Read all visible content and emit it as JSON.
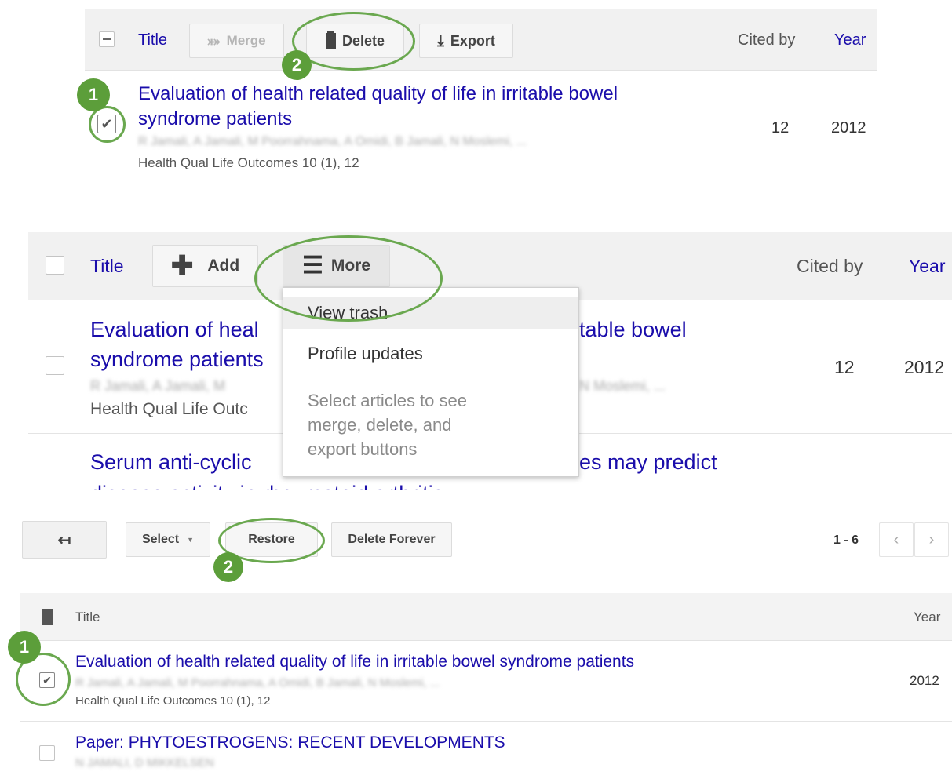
{
  "panel1": {
    "header": {
      "title": "Title",
      "merge": "Merge",
      "delete": "Delete",
      "export": "Export",
      "cited_by": "Cited by",
      "year": "Year"
    },
    "article": {
      "title": "Evaluation of health related quality of life in irritable bowel syndrome patients",
      "authors": "R Jamali, A Jamali, M Poorrahnama, A Omidi, B Jamali, N Moslemi, ...",
      "venue": "Health Qual Life Outcomes 10 (1), 12",
      "cited_by": "12",
      "year": "2012"
    },
    "badges": [
      "1",
      "2"
    ]
  },
  "panel2": {
    "header": {
      "title": "Title",
      "add": "Add",
      "more": "More",
      "cited_by": "Cited by",
      "year": "Year"
    },
    "article1": {
      "title_left_1": "Evaluation of heal",
      "title_right_1": "table bowel",
      "title_left_2": "syndrome patients",
      "authors_left": "R Jamali, A Jamali, M",
      "authors_right": "N Moslemi, ...",
      "venue_left": "Health Qual Life Outc",
      "cited_by": "12",
      "year": "2012"
    },
    "article2": {
      "title_left": "Serum anti-cyclic",
      "title_right": "es may predict",
      "cut_line": "disease activity in rheumatoid arthritis"
    },
    "menu": {
      "view_trash": "View trash",
      "profile_updates": "Profile updates",
      "note_1": "Select articles to see",
      "note_2": "merge, delete, and",
      "note_3": "export buttons"
    }
  },
  "panel3": {
    "toolbar": {
      "select": "Select",
      "restore": "Restore",
      "delete_forever": "Delete Forever",
      "range": "1 - 6"
    },
    "header": {
      "title": "Title",
      "year": "Year"
    },
    "article1": {
      "title": "Evaluation of health related quality of life in irritable bowel syndrome patients",
      "authors": "R Jamali, A Jamali, M Poorrahnama, A Omidi, B Jamali, N Moslemi, ...",
      "venue": "Health Qual Life Outcomes 10 (1), 12",
      "year": "2012"
    },
    "article2": {
      "title": "Paper: PHYTOESTROGENS: RECENT DEVELOPMENTS",
      "authors": "N JAMALI, D MIKKELSEN"
    },
    "badges": [
      "1",
      "2"
    ]
  },
  "colors": {
    "link": "#1a0dab",
    "annotation_green": "#6aa84f",
    "toolbar_bg": "#f1f1f1"
  }
}
